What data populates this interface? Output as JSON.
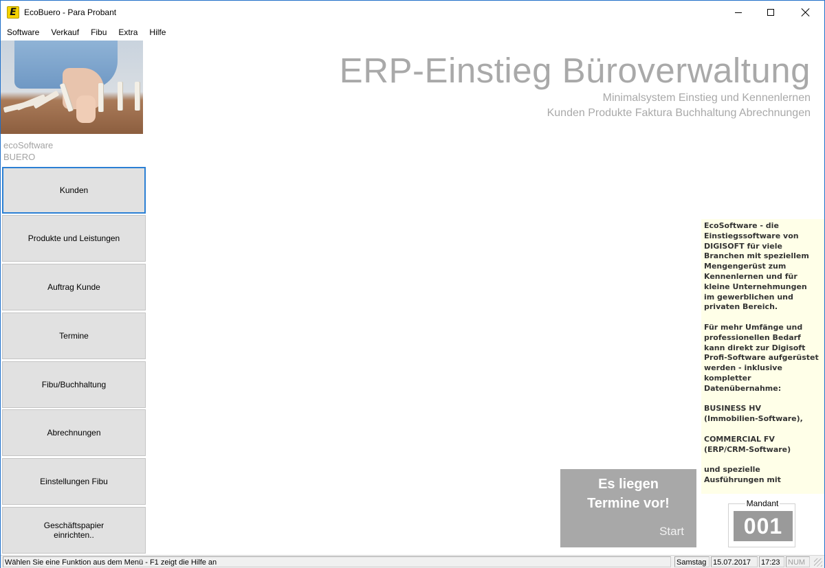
{
  "window": {
    "title": "EcoBuero - Para Probant",
    "logo_letter": "E",
    "controls": {
      "minimize": "minimize",
      "maximize": "maximize",
      "close": "close"
    }
  },
  "menu": [
    "Software",
    "Verkauf",
    "Fibu",
    "Extra",
    "Hilfe"
  ],
  "sidebar": {
    "brand_line1": "ecoSoftware",
    "brand_line2": "BUERO",
    "buttons": [
      {
        "label": "Kunden",
        "active": true
      },
      {
        "label": "Produkte und Leistungen"
      },
      {
        "label": "Auftrag Kunde"
      },
      {
        "label": "Termine"
      },
      {
        "label": "Fibu/Buchhaltung"
      },
      {
        "label": "Abrechnungen"
      },
      {
        "label": "Einstellungen Fibu"
      },
      {
        "label": "Geschäftspapier einrichten.."
      }
    ]
  },
  "main": {
    "title": "ERP-Einstieg Büroverwaltung",
    "subtitle1": "Minimalsystem Einstieg und Kennenlernen",
    "subtitle2": "Kunden Produkte Faktura Buchhaltung Abrechnungen"
  },
  "info": {
    "lines": [
      "EcoSoftware - die",
      "Einstiegssoftware von",
      "DIGISOFT für viele",
      "Branchen mit speziellem",
      "Mengengerüst zum",
      "Kennenlernen und für",
      "kleine Unternehmungen",
      "im gewerblichen und",
      "privaten Bereich.",
      "",
      "Für mehr Umfänge und",
      "professionellen Bedarf",
      "kann direkt zur Digisoft",
      "Profi-Software aufgerüstet",
      "werden - inklusive",
      "kompletter",
      "Datenübernahme:",
      "",
      "BUSINESS HV",
      "(Immobilien-Software),",
      "",
      "COMMERCIAL FV",
      "(ERP/CRM-Software)",
      "",
      "und spezielle",
      "Ausführungen mit"
    ]
  },
  "appointments": {
    "line1": "Es liegen",
    "line2": "Termine vor!",
    "start": "Start"
  },
  "mandant": {
    "label": "Mandant",
    "value": "001"
  },
  "status": {
    "message": "Wählen Sie eine Funktion aus dem Menü - F1 zeigt die Hilfe an",
    "day": "Samstag",
    "date": "15.07.2017",
    "time": "17:23",
    "num": "NUM"
  },
  "colors": {
    "accent": "#2a7fd4",
    "title_gray": "#a9a9a9",
    "info_bg": "#ffffe8",
    "appointment_bg": "#a8a8a8",
    "button_bg": "#e1e1e1"
  }
}
